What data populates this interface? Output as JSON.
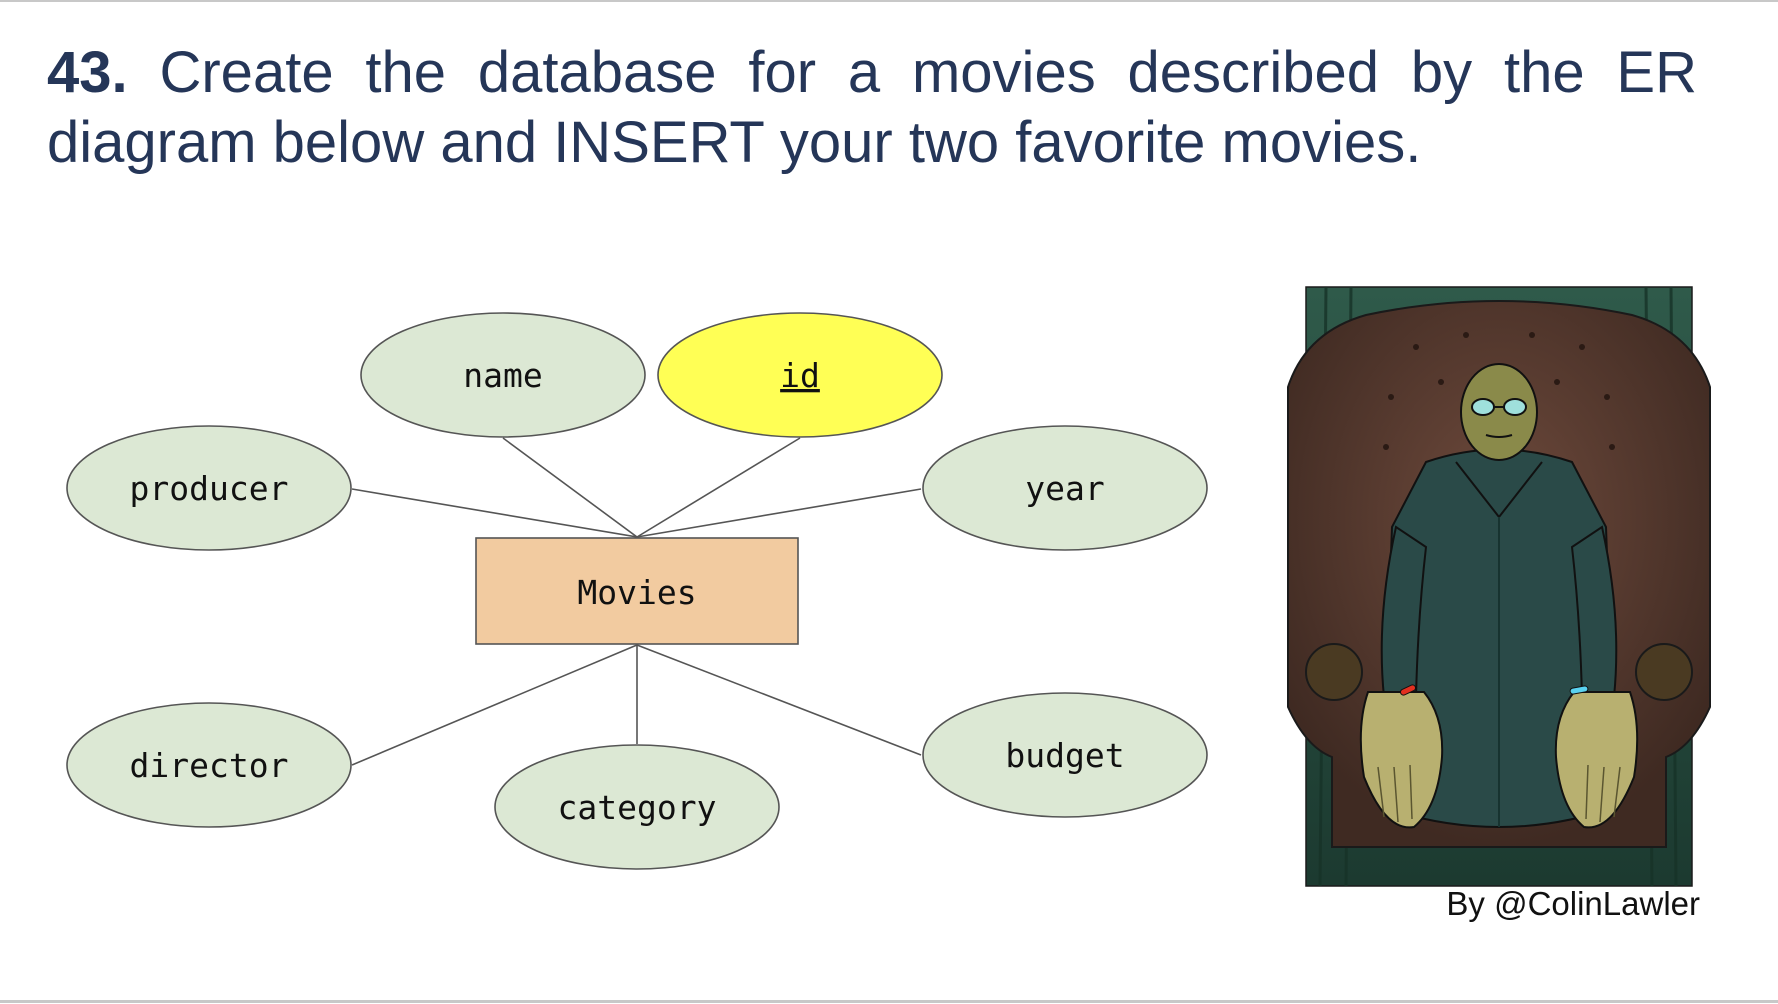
{
  "title": {
    "number": "43.",
    "text": "Create the database for a movies described by the ER diagram below and INSERT your two favorite movies."
  },
  "diagram": {
    "entity": {
      "label": "Movies",
      "color": "#f2cba0"
    },
    "key_attribute": {
      "label": "id",
      "color": "#ffff55"
    },
    "attribute_color": "#dce8d4",
    "attributes": [
      {
        "label": "name"
      },
      {
        "label": "producer"
      },
      {
        "label": "year"
      },
      {
        "label": "director"
      },
      {
        "label": "category"
      },
      {
        "label": "budget"
      }
    ]
  },
  "illustration": {
    "credit": "By @ColinLawler"
  }
}
